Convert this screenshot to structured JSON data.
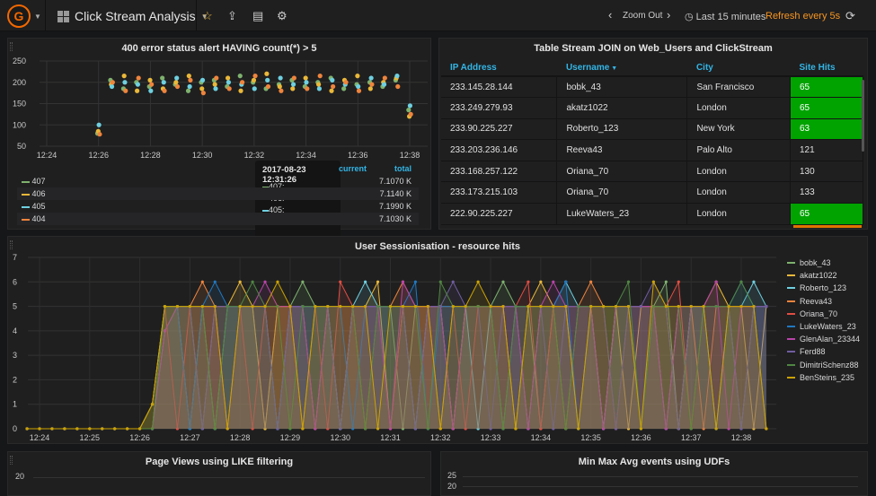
{
  "nav": {
    "title": "Click Stream Analysis",
    "zoom_out": "Zoom Out",
    "time_range": "Last 15 minutes",
    "refresh": "Refresh every 5s"
  },
  "panels": {
    "errors": {
      "title": "400 error status alert HAVING count(*) > 5",
      "legend_headers": {
        "current": "current",
        "total": "total"
      },
      "legend": [
        {
          "name": "407",
          "total": "7.1070 K",
          "color": "#7eb26d"
        },
        {
          "name": "406",
          "total": "7.1140 K",
          "color": "#eab839"
        },
        {
          "name": "405",
          "total": "7.1990 K",
          "color": "#6ed0e0"
        },
        {
          "name": "404",
          "total": "7.1030 K",
          "color": "#ef843c"
        }
      ],
      "tooltip": {
        "time": "2017-08-23 12:31:26",
        "rows": [
          "407:",
          "406:",
          "405:",
          "404:"
        ]
      }
    },
    "table": {
      "title": "Table Stream JOIN on Web_Users and ClickStream",
      "columns": [
        "IP Address",
        "Username",
        "City",
        "Site Hits"
      ],
      "rows": [
        [
          "233.145.28.144",
          "bobk_43",
          "San Francisco",
          "65"
        ],
        [
          "233.249.279.93",
          "akatz1022",
          "London",
          "65"
        ],
        [
          "233.90.225.227",
          "Roberto_123",
          "New York",
          "63"
        ],
        [
          "233.203.236.146",
          "Reeva43",
          "Palo Alto",
          "121"
        ],
        [
          "233.168.257.122",
          "Oriana_70",
          "London",
          "130"
        ],
        [
          "233.173.215.103",
          "Oriana_70",
          "London",
          "133"
        ],
        [
          "222.90.225.227",
          "LukeWaters_23",
          "London",
          "65"
        ]
      ],
      "highlight_color": "#00a300"
    },
    "session": {
      "title": "User Sessionisation - resource hits"
    },
    "pageviews": {
      "title": "Page Views using LIKE filtering"
    },
    "minmax": {
      "title": "Min Max Avg events using UDFs"
    }
  },
  "chart_data": [
    {
      "type": "scatter",
      "title": "400 error status alert HAVING count(*) > 5",
      "ylim": [
        50,
        250
      ],
      "yticks": [
        "250",
        "200",
        "150",
        "100",
        "50"
      ],
      "xticks": [
        "12:24",
        "12:26",
        "12:28",
        "12:30",
        "12:32",
        "12:34",
        "12:36",
        "12:38"
      ],
      "x_start": "12:26:00",
      "x_step_seconds": 30,
      "series": [
        {
          "name": "407",
          "color": "#7eb26d",
          "values": [
            80,
            205,
            185,
            200,
            190,
            210,
            195,
            180,
            200,
            205,
            190,
            215,
            200,
            185,
            195,
            205,
            190,
            200,
            210,
            185,
            195,
            200,
            190,
            205,
            135
          ]
        },
        {
          "name": "406",
          "color": "#eab839",
          "values": [
            85,
            195,
            215,
            180,
            205,
            185,
            200,
            215,
            185,
            195,
            210,
            180,
            205,
            220,
            190,
            185,
            210,
            195,
            180,
            205,
            215,
            185,
            200,
            210,
            120
          ]
        },
        {
          "name": "405",
          "color": "#6ed0e0",
          "values": [
            100,
            190,
            200,
            195,
            180,
            200,
            210,
            190,
            205,
            185,
            200,
            195,
            185,
            205,
            210,
            195,
            200,
            185,
            205,
            195,
            190,
            210,
            195,
            215,
            145
          ]
        },
        {
          "name": "404",
          "color": "#ef843c",
          "values": [
            78,
            200,
            180,
            210,
            195,
            180,
            190,
            205,
            175,
            210,
            185,
            200,
            215,
            190,
            180,
            210,
            185,
            215,
            190,
            200,
            180,
            195,
            210,
            190,
            125
          ]
        }
      ]
    },
    {
      "type": "area",
      "title": "User Sessionisation - resource hits",
      "ylim": [
        0,
        7
      ],
      "yticks": [
        "7",
        "6",
        "5",
        "4",
        "3",
        "2",
        "1",
        "0"
      ],
      "xticks": [
        "12:24",
        "12:25",
        "12:26",
        "12:27",
        "12:28",
        "12:29",
        "12:30",
        "12:31",
        "12:32",
        "12:33",
        "12:34",
        "12:35",
        "12:36",
        "12:37",
        "12:38"
      ],
      "x_start": "12:23:45",
      "x_step_seconds": 15,
      "leading_zeros": 10,
      "series": [
        {
          "name": "bobk_43",
          "color": "#7eb26d",
          "values": [
            1,
            5,
            5,
            5,
            0,
            5,
            5,
            5,
            5,
            0,
            5,
            5,
            6,
            5,
            5,
            0,
            5,
            5,
            5,
            5,
            0,
            5,
            5,
            5,
            0,
            5,
            5,
            5,
            6,
            5,
            5,
            0,
            5,
            5,
            5,
            5,
            0,
            5,
            5,
            5,
            5,
            6,
            0,
            5,
            5,
            5,
            5,
            0,
            5,
            5
          ]
        },
        {
          "name": "akatz1022",
          "color": "#eab839",
          "values": [
            1,
            5,
            5,
            0,
            5,
            5,
            5,
            6,
            5,
            0,
            5,
            5,
            5,
            0,
            5,
            5,
            5,
            5,
            6,
            0,
            5,
            5,
            5,
            5,
            0,
            5,
            5,
            5,
            5,
            0,
            5,
            6,
            5,
            5,
            0,
            5,
            5,
            5,
            0,
            5,
            5,
            5,
            0,
            5,
            5,
            6,
            5,
            5,
            0,
            5
          ]
        },
        {
          "name": "Roberto_123",
          "color": "#6ed0e0",
          "values": [
            0,
            4,
            5,
            5,
            5,
            0,
            5,
            5,
            5,
            5,
            0,
            5,
            5,
            5,
            5,
            0,
            5,
            6,
            5,
            5,
            5,
            0,
            5,
            5,
            5,
            5,
            0,
            5,
            5,
            5,
            0,
            5,
            5,
            6,
            5,
            5,
            0,
            5,
            5,
            5,
            5,
            0,
            5,
            5,
            5,
            0,
            5,
            5,
            6,
            5
          ]
        },
        {
          "name": "Reeva43",
          "color": "#ef843c",
          "values": [
            0,
            5,
            5,
            5,
            6,
            5,
            0,
            5,
            5,
            5,
            5,
            5,
            0,
            5,
            5,
            5,
            5,
            0,
            5,
            5,
            6,
            5,
            5,
            0,
            5,
            5,
            5,
            5,
            0,
            5,
            5,
            5,
            5,
            0,
            5,
            6,
            5,
            5,
            5,
            0,
            5,
            5,
            5,
            5,
            0,
            5,
            5,
            5,
            5,
            0
          ]
        },
        {
          "name": "Oriana_70",
          "color": "#e24d42",
          "values": [
            0,
            5,
            0,
            5,
            5,
            5,
            5,
            5,
            0,
            5,
            5,
            5,
            5,
            5,
            0,
            6,
            5,
            5,
            5,
            0,
            5,
            5,
            5,
            5,
            5,
            0,
            5,
            5,
            5,
            5,
            6,
            0,
            5,
            5,
            5,
            5,
            5,
            0,
            5,
            5,
            5,
            5,
            6,
            0,
            5,
            5,
            5,
            5,
            5,
            0
          ]
        },
        {
          "name": "LukeWaters_23",
          "color": "#1f78c1",
          "values": [
            0,
            5,
            5,
            0,
            5,
            6,
            5,
            5,
            5,
            5,
            0,
            5,
            5,
            5,
            5,
            5,
            0,
            5,
            5,
            5,
            5,
            6,
            0,
            5,
            5,
            5,
            5,
            5,
            0,
            5,
            5,
            5,
            5,
            6,
            0,
            5,
            5,
            5,
            5,
            0,
            5,
            5,
            5,
            5,
            5,
            0,
            5,
            6,
            5,
            5
          ]
        },
        {
          "name": "GlenAlan_23344",
          "color": "#ba43a9",
          "values": [
            0,
            4,
            5,
            5,
            5,
            5,
            0,
            5,
            5,
            6,
            5,
            5,
            5,
            0,
            5,
            5,
            5,
            5,
            5,
            0,
            6,
            5,
            5,
            5,
            0,
            5,
            5,
            5,
            5,
            5,
            0,
            5,
            6,
            5,
            5,
            5,
            0,
            5,
            5,
            5,
            5,
            0,
            5,
            5,
            5,
            6,
            0,
            5,
            5,
            5
          ]
        },
        {
          "name": "Ferd88",
          "color": "#705da0",
          "values": [
            0,
            5,
            5,
            5,
            0,
            5,
            5,
            5,
            5,
            5,
            0,
            5,
            5,
            5,
            5,
            0,
            5,
            5,
            5,
            5,
            5,
            0,
            5,
            5,
            6,
            5,
            5,
            0,
            5,
            5,
            5,
            5,
            0,
            5,
            5,
            5,
            5,
            0,
            5,
            5,
            6,
            5,
            0,
            5,
            5,
            5,
            5,
            0,
            5,
            5
          ]
        },
        {
          "name": "DimitriSchenz88",
          "color": "#508642",
          "values": [
            0,
            5,
            5,
            5,
            5,
            0,
            5,
            5,
            6,
            5,
            5,
            0,
            5,
            5,
            5,
            5,
            5,
            0,
            5,
            5,
            5,
            5,
            0,
            6,
            5,
            5,
            5,
            5,
            0,
            5,
            5,
            5,
            5,
            0,
            5,
            5,
            5,
            5,
            6,
            0,
            5,
            5,
            5,
            0,
            5,
            5,
            5,
            6,
            5,
            0
          ]
        },
        {
          "name": "BenSteins_235",
          "color": "#cca300",
          "values": [
            1,
            5,
            5,
            5,
            5,
            5,
            0,
            5,
            5,
            5,
            6,
            5,
            0,
            5,
            5,
            5,
            5,
            5,
            0,
            5,
            5,
            5,
            5,
            0,
            5,
            5,
            6,
            5,
            5,
            0,
            5,
            5,
            5,
            5,
            0,
            5,
            5,
            5,
            5,
            0,
            6,
            5,
            5,
            5,
            5,
            0,
            5,
            5,
            5,
            0
          ]
        }
      ]
    },
    {
      "type": "line",
      "title": "Page Views using LIKE filtering",
      "yticks": [
        "20"
      ]
    },
    {
      "type": "line",
      "title": "Min Max Avg events using UDFs",
      "yticks": [
        "25",
        "20"
      ]
    }
  ]
}
